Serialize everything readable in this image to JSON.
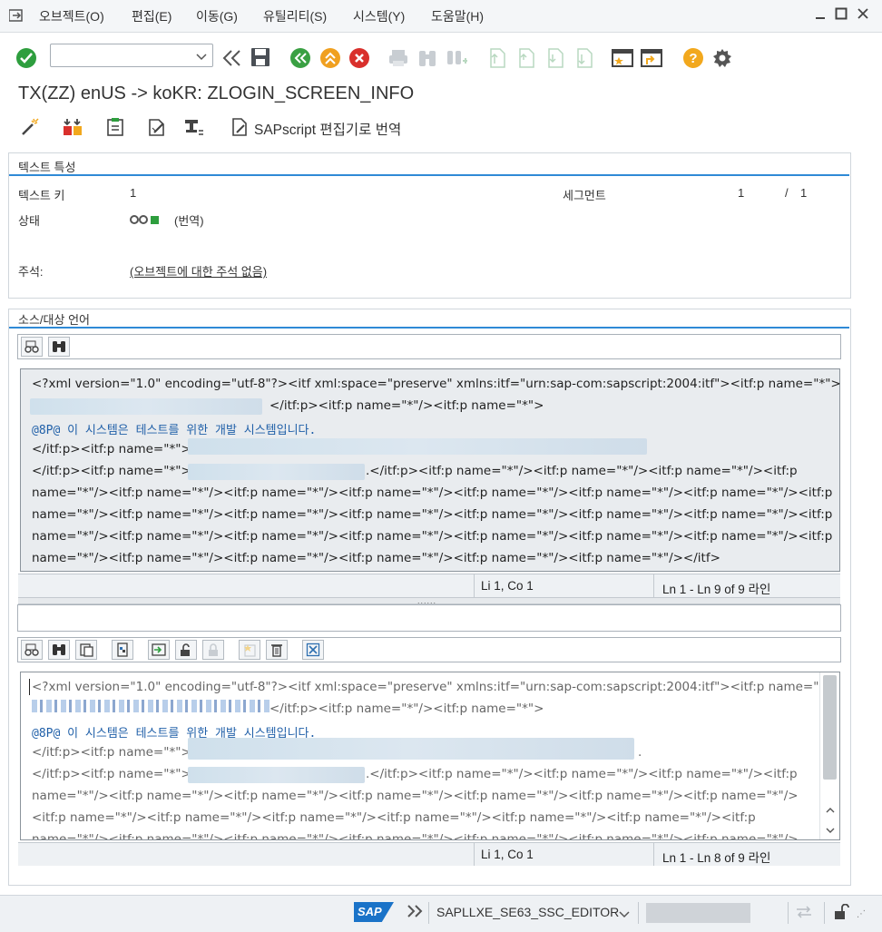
{
  "menu": {
    "items": [
      "오브젝트(O)",
      "편집(E)",
      "이동(G)",
      "유틸리티(S)",
      "시스템(Y)",
      "도움말(H)"
    ]
  },
  "toolbar": {
    "command_value": ""
  },
  "title": "TX(ZZ) enUS -> koKR: ZLOGIN_SCREEN_INFO",
  "app_toolbar": {
    "sapscript_label": "SAPscript 편집기로 번역"
  },
  "text_attributes": {
    "group_title": "텍스트 특성",
    "text_key_label": "텍스트 키",
    "text_key_value": "1",
    "segment_label": "세그먼트",
    "segment_current": "1",
    "segment_slash": "/",
    "segment_total": "1",
    "status_label": "상태",
    "status_value": "(번역)",
    "comment_label": "주석:",
    "comment_value": "(오브젝트에 대한 주석 없음)"
  },
  "source_target": {
    "group_title": "소스/대상 언어"
  },
  "source_editor": {
    "lines": [
      "<?xml version=\"1.0\" encoding=\"utf-8\"?><itf xml:space=\"preserve\" xmlns:itf=\"urn:sap-com:sapscript:2004:itf\"><itf:p name=\"*\">",
      "</itf:p><itf:p name=\"*\"/><itf:p name=\"*\">",
      "@8P@ 이 시스템은 테스트를 위한 개발 시스템입니다.",
      "</itf:p><itf:p name=\"*\">",
      "</itf:p><itf:p name=\"*\">",
      ".</itf:p><itf:p name=\"*\"/><itf:p name=\"*\"/><itf:p name=\"*\"/><itf:p",
      "name=\"*\"/><itf:p name=\"*\"/><itf:p name=\"*\"/><itf:p name=\"*\"/><itf:p name=\"*\"/><itf:p name=\"*\"/><itf:p name=\"*\"/><itf:p",
      "name=\"*\"/><itf:p name=\"*\"/><itf:p name=\"*\"/><itf:p name=\"*\"/><itf:p name=\"*\"/><itf:p name=\"*\"/><itf:p name=\"*\"/><itf:p",
      "name=\"*\"/><itf:p name=\"*\"/><itf:p name=\"*\"/><itf:p name=\"*\"/><itf:p name=\"*\"/><itf:p name=\"*\"/><itf:p name=\"*\"/><itf:p",
      "name=\"*\"/><itf:p name=\"*\"/><itf:p name=\"*\"/><itf:p name=\"*\"/><itf:p name=\"*\"/><itf:p name=\"*\"/></itf>"
    ],
    "position": "Li 1, Co 1",
    "line_info": "Ln 1 - Ln 9 of 9 라인"
  },
  "target_editor": {
    "lines": [
      "<?xml version=\"1.0\" encoding=\"utf-8\"?><itf xml:space=\"preserve\" xmlns:itf=\"urn:sap-com:sapscript:2004:itf\"><itf:p name=\"*\">",
      "</itf:p><itf:p name=\"*\"/><itf:p name=\"*\">",
      "@8P@ 이 시스템은 테스트를 위한 개발 시스템입니다.",
      "</itf:p><itf:p name=\"*\">",
      ".",
      "</itf:p><itf:p name=\"*\">",
      ".</itf:p><itf:p name=\"*\"/><itf:p name=\"*\"/><itf:p name=\"*\"/><itf:p",
      "name=\"*\"/><itf:p name=\"*\"/><itf:p name=\"*\"/><itf:p name=\"*\"/><itf:p name=\"*\"/><itf:p name=\"*\"/><itf:p name=\"*\"/>",
      "<itf:p name=\"*\"/><itf:p name=\"*\"/><itf:p name=\"*\"/><itf:p name=\"*\"/><itf:p name=\"*\"/><itf:p name=\"*\"/><itf:p",
      "name=\"*\"/><itf:p name=\"*\"/><itf:p name=\"*\"/><itf:p name=\"*\"/><itf:p name=\"*\"/><itf:p name=\"*\"/><itf:p name=\"*\"/>"
    ],
    "position": "Li 1, Co 1",
    "line_info": "Ln 1 - Ln 8 of 9 라인"
  },
  "footer": {
    "brand": "SAP",
    "transaction": "SAPLLXE_SE63_SSC_EDITOR"
  },
  "colors": {
    "accent_blue": "#2f8ad6",
    "ok_green": "#2e9e3e",
    "back_green": "#3aa043",
    "exit_orange": "#f0a020",
    "cancel_red": "#d9302c",
    "help_yellow": "#f2a81d"
  }
}
